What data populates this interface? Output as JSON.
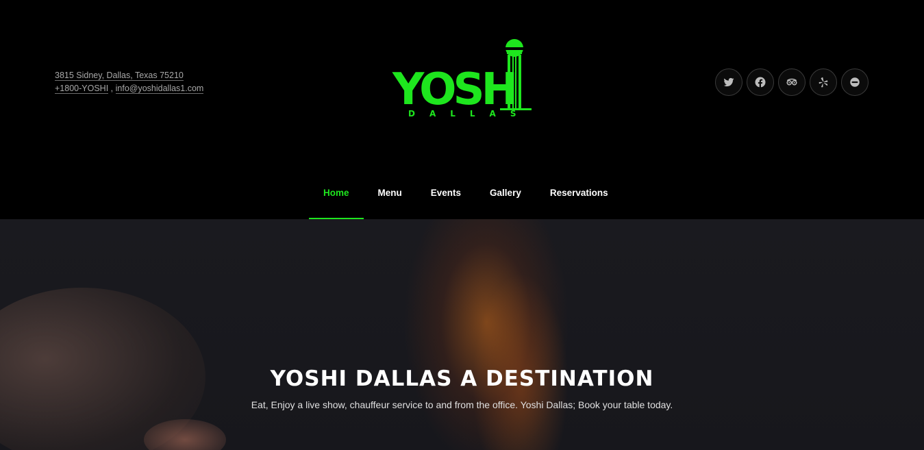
{
  "header": {
    "address": "3815 Sidney, Dallas, Texas 75210",
    "phone": "+1800-YOSHI",
    "separator": ",",
    "email": "info@yoshidallas1.com"
  },
  "logo": {
    "name": "YOSHI",
    "subtitle": "DALLAS",
    "color": "#1ee61e"
  },
  "social": [
    {
      "icon": "twitter-icon"
    },
    {
      "icon": "facebook-icon"
    },
    {
      "icon": "tripadvisor-icon"
    },
    {
      "icon": "yelp-icon"
    },
    {
      "icon": "opentable-icon"
    }
  ],
  "nav": {
    "items": [
      {
        "label": "Home",
        "active": true
      },
      {
        "label": "Menu",
        "active": false
      },
      {
        "label": "Events",
        "active": false
      },
      {
        "label": "Gallery",
        "active": false
      },
      {
        "label": "Reservations",
        "active": false
      }
    ],
    "active_color": "#1ee61e"
  },
  "hero": {
    "title": "YOSHI DALLAS A DESTINATION",
    "subtitle": "Eat, Enjoy a live show, chauffeur service to and from the office. Yoshi Dallas; Book your table today."
  }
}
